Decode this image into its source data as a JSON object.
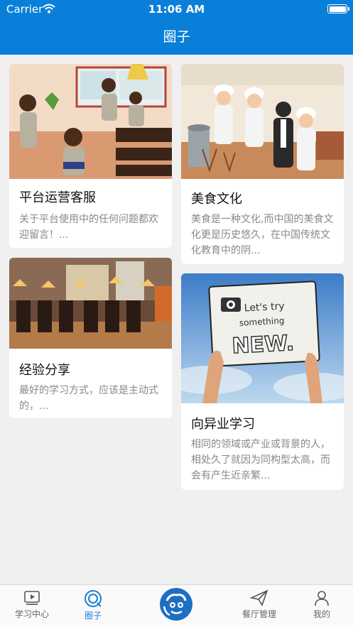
{
  "status_bar": {
    "carrier": "Carrier",
    "time": "11:06 AM"
  },
  "nav": {
    "title": "圈子"
  },
  "cards": [
    {
      "title": "平台运营客服",
      "desc": "关于平台使用中的任何问题都欢迎留言！..."
    },
    {
      "title": "美食文化",
      "desc": "美食是一种文化,而中国的美食文化更是历史悠久，在中国传统文化教育中的阴..."
    },
    {
      "title": "经验分享",
      "desc": "最好的学习方式，应该是主动式的，..."
    },
    {
      "title": "向异业学习",
      "desc": "相同的领域或产业或背景的人，相处久了就因为同构型太高，而会有产生近亲繁...",
      "image_text": [
        "Let's try",
        "something",
        "NEW."
      ]
    }
  ],
  "tabs": [
    {
      "label": "学习中心",
      "icon": "video-icon"
    },
    {
      "label": "圈子",
      "icon": "chat-circle-icon",
      "active": true
    },
    {
      "label": "",
      "icon": "center-avatar-icon"
    },
    {
      "label": "餐厅管理",
      "icon": "paper-plane-icon"
    },
    {
      "label": "我的",
      "icon": "person-icon"
    }
  ],
  "colors": {
    "primary": "#0a7fd9",
    "active_tab": "#1a7fd6",
    "background": "#f0f0f0"
  }
}
